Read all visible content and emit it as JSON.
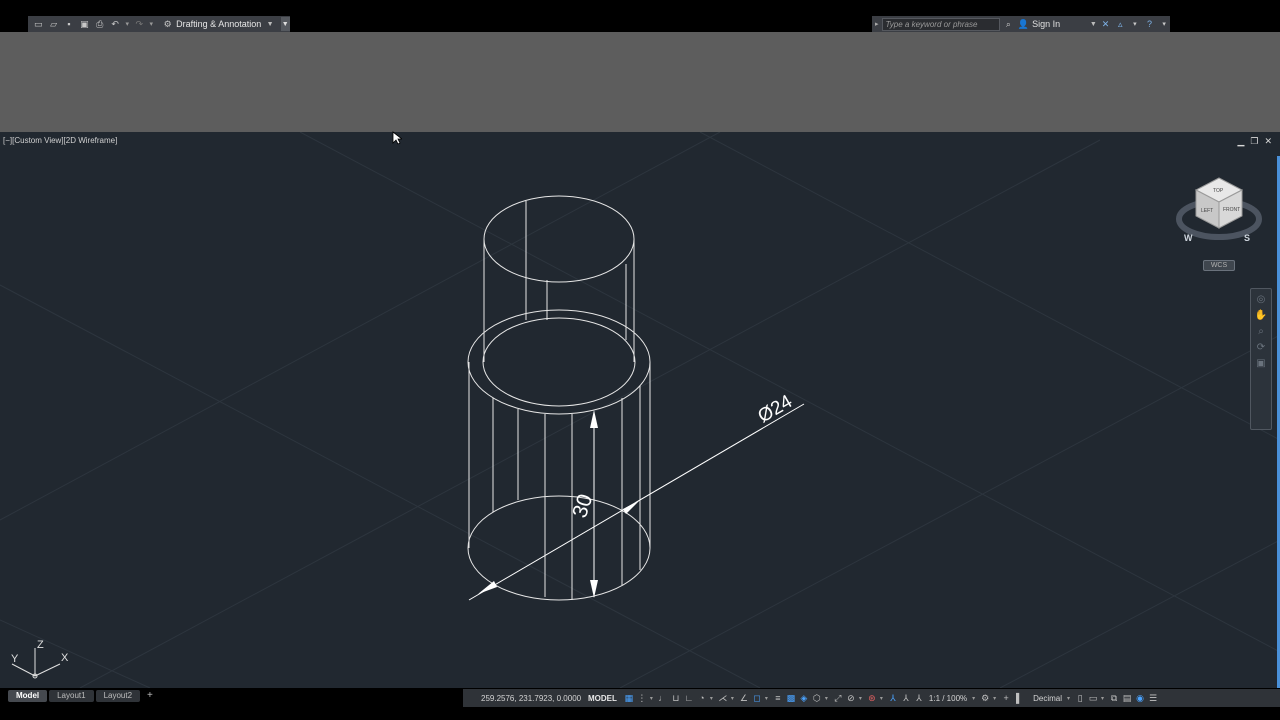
{
  "titlebar": {
    "workspace_label": "Drafting & Annotation",
    "search_placeholder": "Type a keyword or phrase",
    "signin_label": "Sign In"
  },
  "viewport": {
    "label": "[−][Custom View][2D Wireframe]",
    "dim_height": "30",
    "dim_diameter": "Ø24"
  },
  "viewcube": {
    "faces": {
      "top": "TOP",
      "left": "LEFT",
      "front": "FRONT"
    },
    "compass": {
      "n": "N",
      "s": "S",
      "e": "E",
      "w": "W"
    },
    "wcs_label": "WCS"
  },
  "ucs": {
    "x": "X",
    "y": "Y",
    "z": "Z"
  },
  "layout_tabs": [
    {
      "label": "Model",
      "active": true
    },
    {
      "label": "Layout1",
      "active": false
    },
    {
      "label": "Layout2",
      "active": false
    }
  ],
  "status": {
    "coordinates": "259.2576, 231.7923, 0.0000",
    "model_label": "MODEL",
    "scale_label": "1:1 / 100%",
    "units_label": "Decimal"
  },
  "colors": {
    "viewport_bg": "#212830",
    "ribbon_bg": "#5d5d5d",
    "accent": "#4aa3ff"
  }
}
